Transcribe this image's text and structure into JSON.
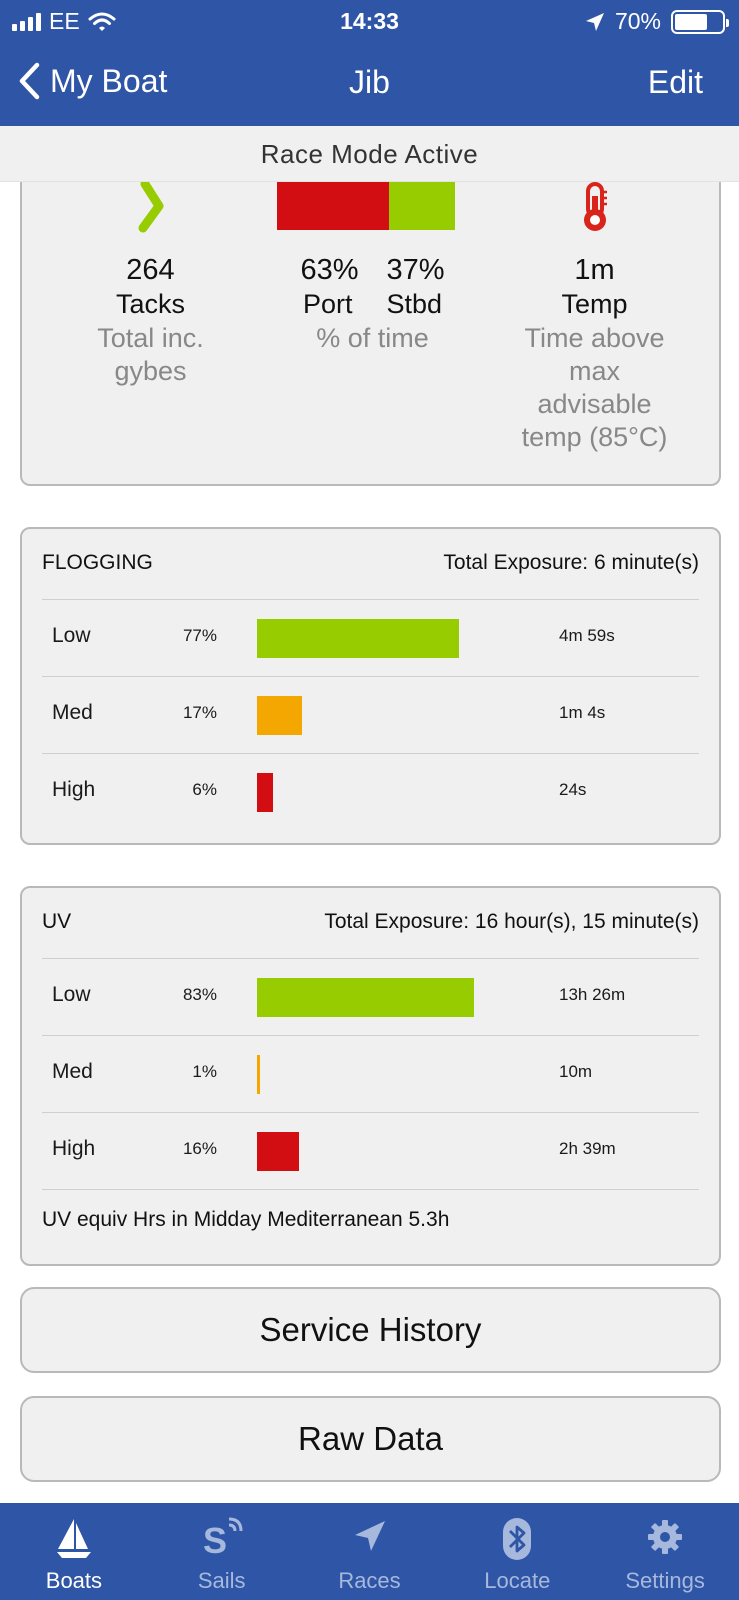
{
  "status_bar": {
    "carrier": "EE",
    "time": "14:33",
    "battery": "70%",
    "battery_level": 0.7
  },
  "nav": {
    "back_label": "My Boat",
    "title": "Jib",
    "edit_label": "Edit"
  },
  "banner": {
    "text": "Race Mode Active"
  },
  "summary": {
    "tacks": {
      "value": "264",
      "name": "Tacks",
      "desc_lines": [
        "Total inc.",
        "gybes"
      ]
    },
    "side": {
      "port_pct": "63%",
      "stbd_pct": "37%",
      "port_label": "Port",
      "stbd_label": "Stbd",
      "desc": "% of time",
      "port_fraction": 0.63,
      "stbd_fraction": 0.37
    },
    "temp": {
      "value": "1m",
      "name": "Temp",
      "desc_lines": [
        "Time above",
        "max",
        "advisable",
        "temp (85°C)"
      ]
    }
  },
  "flogging": {
    "title": "FLOGGING",
    "total": "Total Exposure: 6 minute(s)",
    "rows": [
      {
        "level": "Low",
        "pct": "77%",
        "duration": "4m 59s",
        "fraction": 0.77,
        "color": "#96cc00"
      },
      {
        "level": "Med",
        "pct": "17%",
        "duration": "1m 4s",
        "fraction": 0.17,
        "color": "#f4a700"
      },
      {
        "level": "High",
        "pct": "6%",
        "duration": "24s",
        "fraction": 0.06,
        "color": "#d20e12"
      }
    ]
  },
  "uv": {
    "title": "UV",
    "total": "Total Exposure: 16 hour(s), 15 minute(s)",
    "rows": [
      {
        "level": "Low",
        "pct": "83%",
        "duration": "13h 26m",
        "fraction": 0.83,
        "color": "#96cc00"
      },
      {
        "level": "Med",
        "pct": "1%",
        "duration": "10m",
        "fraction": 0.01,
        "color": "#f4a700"
      },
      {
        "level": "High",
        "pct": "16%",
        "duration": "2h 39m",
        "fraction": 0.16,
        "color": "#d20e12"
      }
    ],
    "footnote": "UV equiv Hrs in Midday Mediterranean 5.3h"
  },
  "buttons": {
    "service_history": "Service History",
    "raw_data": "Raw Data"
  },
  "colors": {
    "brand": "#2f55a6",
    "port": "#d20e12",
    "stbd": "#96cc00",
    "tack_icon": "#96cc00",
    "temp_icon": "#d8241a"
  },
  "tabs": [
    {
      "label": "Boats",
      "icon": "sailboat-icon",
      "active": true
    },
    {
      "label": "Sails",
      "icon": "sail-signal-icon",
      "active": false
    },
    {
      "label": "Races",
      "icon": "location-arrow-icon",
      "active": false
    },
    {
      "label": "Locate",
      "icon": "bluetooth-icon",
      "active": false
    },
    {
      "label": "Settings",
      "icon": "gear-icon",
      "active": false
    }
  ]
}
